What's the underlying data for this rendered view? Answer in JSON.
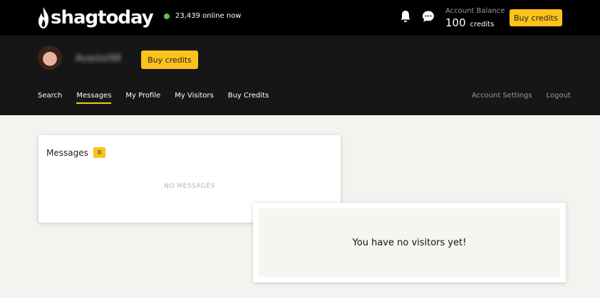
{
  "brand": {
    "logo_text": "shagtoday"
  },
  "online": {
    "text": "23,439 online now",
    "dot_color": "#6ac13b"
  },
  "header": {
    "notification_icon": "bell-icon",
    "messages_icon": "chat-bubble-icon",
    "balance_label": "Account Balance",
    "balance_amount": "100",
    "balance_unit": "credits",
    "buy_credits_label": "Buy credits"
  },
  "profile": {
    "username": "Avastol98",
    "buy_credits_label": "Buy credits"
  },
  "nav": {
    "items": [
      "Search",
      "Messages",
      "My Profile",
      "My Visitors",
      "Buy Credits"
    ],
    "active": "Messages",
    "right_items": [
      "Account Settings",
      "Logout"
    ]
  },
  "messages": {
    "title": "Messages",
    "count": "0",
    "empty_text": "NO MESSAGES"
  },
  "visitors": {
    "empty_text": "You have no visitors yet!"
  },
  "colors": {
    "accent": "#fcc31c",
    "topbar": "#000000",
    "subheader": "#161616",
    "page_background": "#f4f3f0"
  }
}
